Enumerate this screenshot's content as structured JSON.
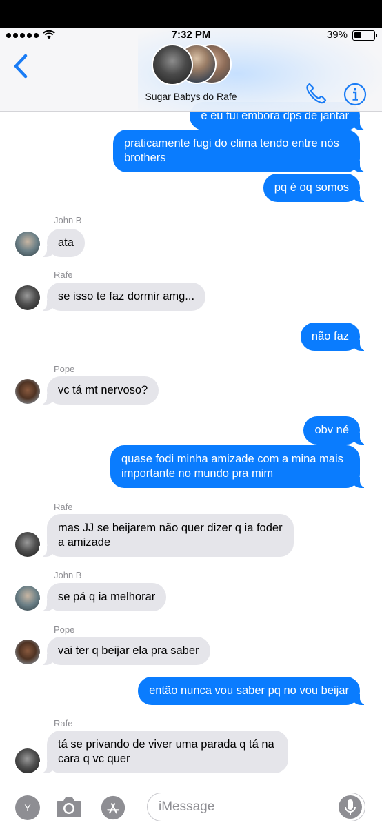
{
  "status_bar": {
    "time": "7:32 PM",
    "battery": "39%",
    "battery_level": 0.39
  },
  "header": {
    "group_name": "Sugar Babys do Rafe",
    "icons": [
      "back-chevron-icon",
      "phone-icon",
      "info-icon"
    ]
  },
  "messages": [
    {
      "from": "me",
      "text": "e eu fui embora dps de jantar"
    },
    {
      "from": "me",
      "text": "praticamente fugi do clima tendo entre nós brothers"
    },
    {
      "from": "me",
      "text": "pq é oq somos"
    },
    {
      "from": "John B",
      "text": "ata"
    },
    {
      "from": "Rafe",
      "text": "se isso te faz dormir amg..."
    },
    {
      "from": "me",
      "text": "não faz"
    },
    {
      "from": "Pope",
      "text": "vc tá mt nervoso?"
    },
    {
      "from": "me",
      "text": "obv né"
    },
    {
      "from": "me",
      "text": "quase fodi minha amizade com a mina mais importante no mundo pra mim"
    },
    {
      "from": "Rafe",
      "text": "mas JJ se beijarem não quer dizer q ia foder a amizade"
    },
    {
      "from": "John B",
      "text": "se pá q ia melhorar"
    },
    {
      "from": "Pope",
      "text": "vai ter q beijar ela pra saber"
    },
    {
      "from": "me",
      "text": "então nunca vou saber pq no vou beijar"
    },
    {
      "from": "Rafe",
      "text": "tá se privando de viver uma parada q tá na cara q vc quer"
    }
  ],
  "input_bar": {
    "apps_button": "Y",
    "placeholder": "iMessage",
    "icons": [
      "camera-icon",
      "app-store-icon",
      "microphone-icon"
    ]
  },
  "colors": {
    "outgoing_bubble": "#0a7cfe",
    "incoming_bubble": "#e5e5ea",
    "accent": "#1a7cf5"
  }
}
